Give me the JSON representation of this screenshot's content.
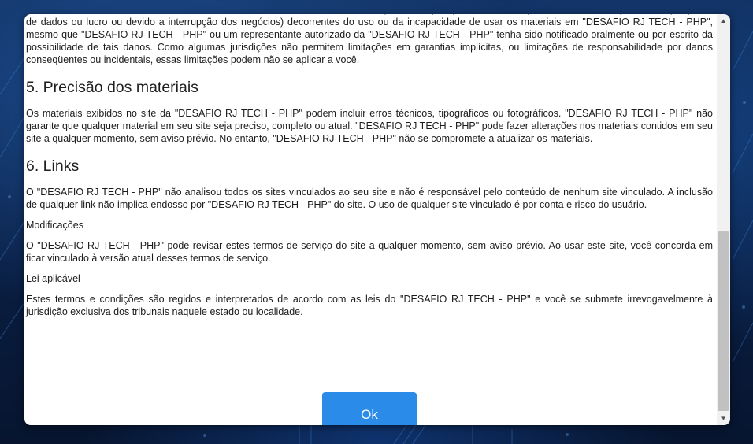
{
  "modal": {
    "top_partial_text": "Em nenhum caso o \"DESAFIO RJ TECH - PHP\" ou seus fornecedores serão responsáveis por quaisquer danos (incluindo, sem limitação, danos por perda de dados ou lucro ou devido a interrupção dos negócios) decorrentes do uso ou da incapacidade de usar os materiais em \"DESAFIO RJ TECH - PHP\", mesmo que \"DESAFIO RJ TECH - PHP\" ou um representante autorizado da \"DESAFIO RJ TECH - PHP\" tenha sido notificado oralmente ou por escrito da possibilidade de tais danos. Como algumas jurisdições não permitem limitações em garantias implícitas, ou limitações de responsabilidade por danos conseqüentes ou incidentais, essas limitações podem não se aplicar a você.",
    "section5_heading": "5. Precisão dos materiais",
    "section5_text": "Os materiais exibidos no site da \"DESAFIO RJ TECH - PHP\" podem incluir erros técnicos, tipográficos ou fotográficos. \"DESAFIO RJ TECH - PHP\" não garante que qualquer material em seu site seja preciso, completo ou atual. \"DESAFIO RJ TECH - PHP\" pode fazer alterações nos materiais contidos em seu site a qualquer momento, sem aviso prévio. No entanto, \"DESAFIO RJ TECH - PHP\" não se compromete a atualizar os materiais.",
    "section6_heading": "6. Links",
    "section6_text": "O \"DESAFIO RJ TECH - PHP\" não analisou todos os sites vinculados ao seu site e não é responsável pelo conteúdo de nenhum site vinculado. A inclusão de qualquer link não implica endosso por \"DESAFIO RJ TECH - PHP\" do site. O uso de qualquer site vinculado é por conta e risco do usuário.",
    "modificacoes_label": "Modificações",
    "modificacoes_text": "O \"DESAFIO RJ TECH - PHP\" pode revisar estes termos de serviço do site a qualquer momento, sem aviso prévio. Ao usar este site, você concorda em ficar vinculado à versão atual desses termos de serviço.",
    "lei_label": "Lei aplicável",
    "lei_text": "Estes termos e condições são regidos e interpretados de acordo com as leis do \"DESAFIO RJ TECH - PHP\" e você se submete irrevogavelmente à jurisdição exclusiva dos tribunais naquele estado ou localidade.",
    "ok_label": "Ok"
  },
  "scrollbar": {
    "up_icon": "▲",
    "down_icon": "▼"
  },
  "colors": {
    "button": "#2b8be8",
    "background": "#0a1f44"
  }
}
